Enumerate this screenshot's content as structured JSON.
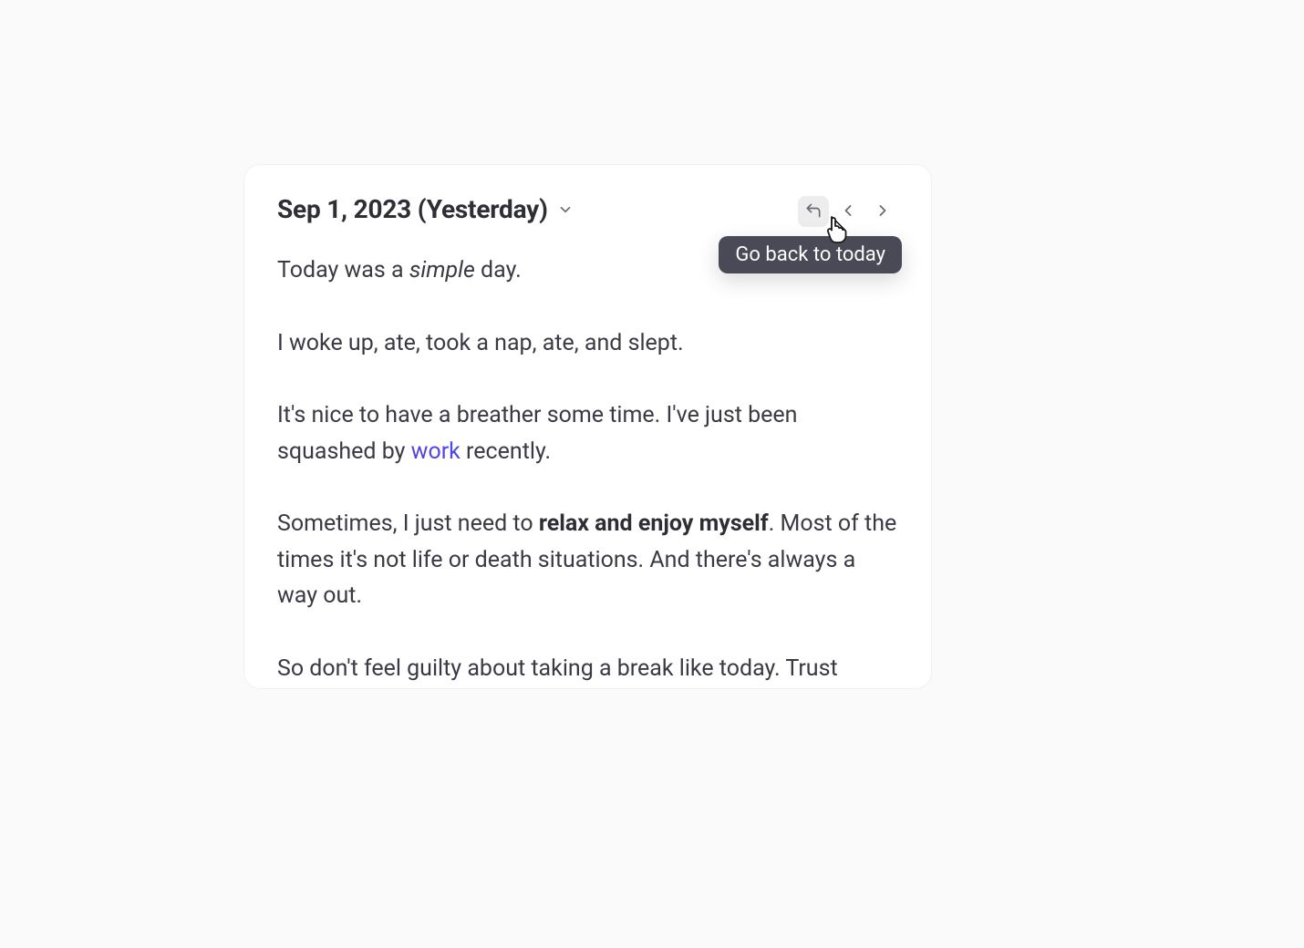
{
  "header": {
    "date_title": "Sep 1, 2023 (Yesterday)",
    "tooltip": "Go back to today",
    "icons": {
      "back_today": "undo-icon",
      "prev": "chevron-left-icon",
      "next": "chevron-right-icon",
      "dropdown": "chevron-down-icon"
    }
  },
  "entry": {
    "p1": {
      "t1": "Today was a ",
      "em": "simple",
      "t2": " day."
    },
    "p2": "I woke up, ate, took a nap, ate, and slept.",
    "p3": {
      "t1": "It's nice to have a breather some time. I've just been squashed by ",
      "link": "work",
      "t2": " recently."
    },
    "p4": {
      "t1": "Sometimes, I just need to ",
      "bold": "relax and enjoy myself",
      "t2": ". Most of the times it's not life or death situations. And there's always a way out."
    },
    "p5": "So don't feel guilty about taking a break like today. Trust"
  },
  "colors": {
    "link": "#4f46e5",
    "tooltip_bg": "#4a4a57",
    "text": "#3a3a44",
    "heading": "#2e2e35"
  }
}
